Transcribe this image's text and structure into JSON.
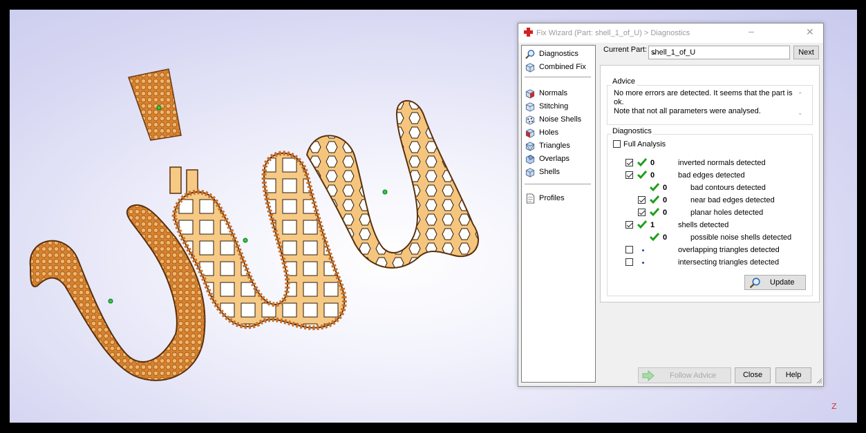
{
  "dialog": {
    "title": "Fix Wizard (Part: shell_1_of_U) > Diagnostics",
    "minimize": "–",
    "close_glyph": "✕"
  },
  "sidebar": {
    "items": [
      {
        "label": "Diagnostics",
        "icon": "magnifier-icon"
      },
      {
        "label": "Combined Fix",
        "icon": "cube-icon"
      },
      {
        "label": "Normals",
        "icon": "normals-cube-icon"
      },
      {
        "label": "Stitching",
        "icon": "stitching-cube-icon"
      },
      {
        "label": "Noise Shells",
        "icon": "noise-shells-icon"
      },
      {
        "label": "Holes",
        "icon": "holes-cube-icon"
      },
      {
        "label": "Triangles",
        "icon": "triangles-cube-icon"
      },
      {
        "label": "Overlaps",
        "icon": "overlaps-cube-icon"
      },
      {
        "label": "Shells",
        "icon": "shells-cube-icon"
      },
      {
        "label": "Profiles",
        "icon": "profiles-page-icon"
      }
    ]
  },
  "header": {
    "current_part_label": "Current Part:",
    "current_part_value": "shell_1_of_U",
    "next_label": "Next"
  },
  "advice": {
    "title": "Advice",
    "line1": "No more errors are detected. It seems that the part is ok.",
    "line2": "Note that not all parameters were analysed."
  },
  "diagnostics": {
    "title": "Diagnostics",
    "full_analysis_label": "Full Analysis",
    "rows": [
      {
        "checkbox": true,
        "checked": true,
        "status": "tick",
        "count": "0",
        "text": "inverted normals detected"
      },
      {
        "checkbox": true,
        "checked": true,
        "status": "tick",
        "count": "0",
        "text": "bad edges detected"
      },
      {
        "checkbox": false,
        "checked": false,
        "status": "tick",
        "count": "0",
        "text": "bad contours detected"
      },
      {
        "checkbox": true,
        "checked": true,
        "status": "tick",
        "count": "0",
        "text": "near bad edges detected"
      },
      {
        "checkbox": true,
        "checked": true,
        "status": "tick",
        "count": "0",
        "text": "planar holes detected"
      },
      {
        "checkbox": true,
        "checked": true,
        "status": "tick",
        "count": "1",
        "text": "shells detected"
      },
      {
        "checkbox": false,
        "checked": false,
        "status": "tick",
        "count": "0",
        "text": "possible noise shells detected"
      },
      {
        "checkbox": true,
        "checked": false,
        "status": "dot",
        "count": "",
        "text": "overlapping triangles detected"
      },
      {
        "checkbox": true,
        "checked": false,
        "status": "dot",
        "count": "",
        "text": "intersecting triangles detected"
      }
    ],
    "update_label": "Update"
  },
  "footer": {
    "follow_advice_label": "Follow Advice",
    "close_label": "Close",
    "help_label": "Help"
  },
  "scene": {
    "axis_label": "Z"
  },
  "colors": {
    "gold": "#f2c27a",
    "gold_dark": "#c8782a",
    "tick_green": "#1e9e1e",
    "titlebar_close_red": "#d62020"
  }
}
